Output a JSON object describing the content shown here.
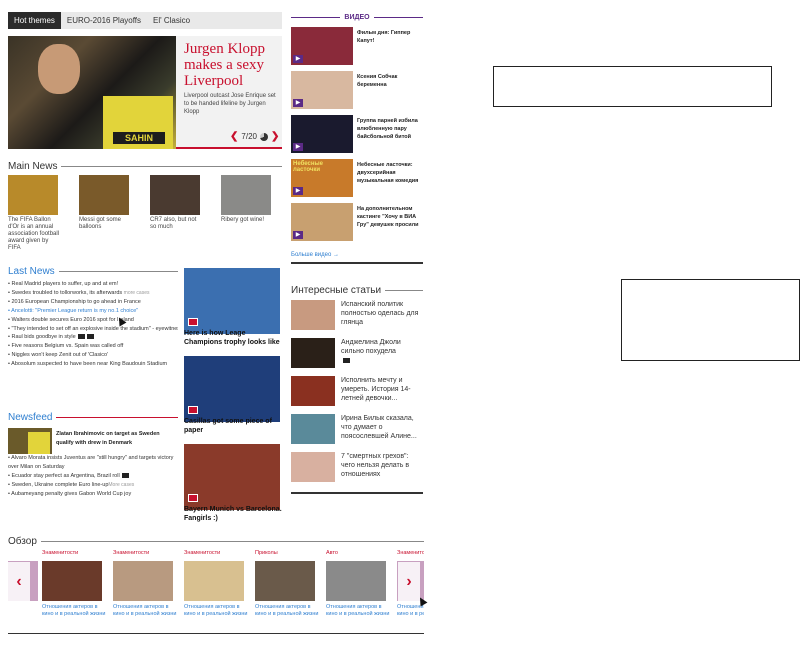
{
  "tabs": [
    "Hot themes",
    "EURO-2016 Playoffs",
    "El' Clasico"
  ],
  "hero": {
    "jersey_text": "SAHIN",
    "title": "Jurgen Klopp makes a sexy Liverpool",
    "subtitle": "Liverpool outcast Jose Enrique set to be handed lifeline by Jurgen Klopp",
    "counter": "7/20"
  },
  "main_news": {
    "heading": "Main News",
    "items": [
      {
        "caption": "The FIFA Ballon d'Or is an annual association football award given by FIFA",
        "color": "#b88a2a"
      },
      {
        "caption": "Messi got some balloons",
        "color": "#7a5a2a"
      },
      {
        "caption": "CR7 also, but not so much",
        "color": "#4a3a30"
      },
      {
        "caption": "Ribery got wine!",
        "color": "#8a8a88"
      }
    ]
  },
  "last_news": {
    "heading": "Last News",
    "items": [
      {
        "text": "Real Madrid players to suffer, up and at em!"
      },
      {
        "text": "Swedes troubled to tollorworks, its afterwards ",
        "muted": "more cases"
      },
      {
        "text": "2016 European Championship to go ahead in France"
      },
      {
        "text": "Ancelotti: \"Premier League return is my no.1 choice\"",
        "link": true
      },
      {
        "text": "Walters double secures Euro 2016 spot for Ireland"
      },
      {
        "text": "\"They intended to set off an explosive inside the stadium\" - eyewitness"
      },
      {
        "text": "Raul bids goodbye in style",
        "icons": true
      },
      {
        "text": "Five reasons Belgium vs. Spain was called off"
      },
      {
        "text": "Niggles won't keep Zenit out of 'Clasico'"
      },
      {
        "text": "Abosolum suspected to have been near King Baudouin Stadium"
      }
    ]
  },
  "newsfeed": {
    "heading": "Newsfeed",
    "lead": "Zlatan Ibrahimovic on target as Sweden qualify with drew in Denmark",
    "items": [
      {
        "text": "Alvaro Morata insists Juventus are \"still hungry\" and targets victory over Milan on Saturday"
      },
      {
        "text": "Ecuador stay perfect as Argentina, Brazil roll"
      },
      {
        "text": "Sweden, Ukraine complete Euro line-up",
        "muted": "More cases"
      },
      {
        "text": "Aubameyang penalty gives Gabon World Cup joy"
      }
    ]
  },
  "right_cards": [
    {
      "title": "Here is how Leage Champions trophy looks like",
      "color": "#3b6fb0"
    },
    {
      "title": "Casillas got some piece of paper",
      "color": "#1f3e7a"
    },
    {
      "title": "Bayern Munich vs Barcelona. Fangirls :)",
      "color": "#8a3a2a"
    }
  ],
  "video": {
    "heading": "ВИДЕО",
    "items": [
      {
        "text": "Фильм дня: Гиппер Капут!",
        "color": "#8a2a3a"
      },
      {
        "text": "Ксения Собчак беременна",
        "color": "#d8b8a0"
      },
      {
        "text": "Группа парней избила влюбленную пару байсбольной битой",
        "color": "#1a1a2e"
      },
      {
        "text": "Небесные ласточки: двухсерийная музыкальная комедия",
        "color": "#c87a2a",
        "overlay": "Небесные ласточки"
      },
      {
        "text": "На дополнительном кастинге \"Хочу в ВИА Гру\" девушек просили",
        "color": "#c8a070"
      }
    ],
    "more": "Больше видео →"
  },
  "interesting": {
    "heading": "Интересные статьи",
    "items": [
      {
        "text": "Испанский политик полностью оделась для глянца",
        "color": "#c89a80"
      },
      {
        "text": "Анджелина Джоли сильно похудела",
        "color": "#2a2018",
        "camera": true
      },
      {
        "text": "Исполнить мечту и умереть. История 14-летней девочки...",
        "color": "#8a3020"
      },
      {
        "text": "Ирина Билык сказала, что думает о поясослевшей Алине...",
        "color": "#5a8a9a"
      },
      {
        "text": "7 \"смертных грехов\": чего нельзя делать в отношениях",
        "color": "#d8b0a0"
      }
    ]
  },
  "obzor": {
    "heading": "Обзор",
    "items": [
      {
        "category": "Знаменитости",
        "text": "Отношения актеров в кино и в реальной жизни",
        "color": "#6a3a2a"
      },
      {
        "category": "Знаменитости",
        "text": "Отношения актеров в кино и в реальной жизни",
        "color": "#b89a80"
      },
      {
        "category": "Знаменитости",
        "text": "Отношения актеров в кино и в реальной жизни",
        "color": "#d8c090"
      },
      {
        "category": "Приколы",
        "text": "Отношения актеров в кино и в реальной жизни",
        "color": "#6a5a4a"
      },
      {
        "category": "Авто",
        "text": "Отношения актеров в кино и в реальной жизни",
        "color": "#8a8a8a"
      },
      {
        "category": "Знаменитости",
        "text": "Отношения актеров в кино и в реальной жизни",
        "color": "#c8a0c0"
      }
    ]
  }
}
